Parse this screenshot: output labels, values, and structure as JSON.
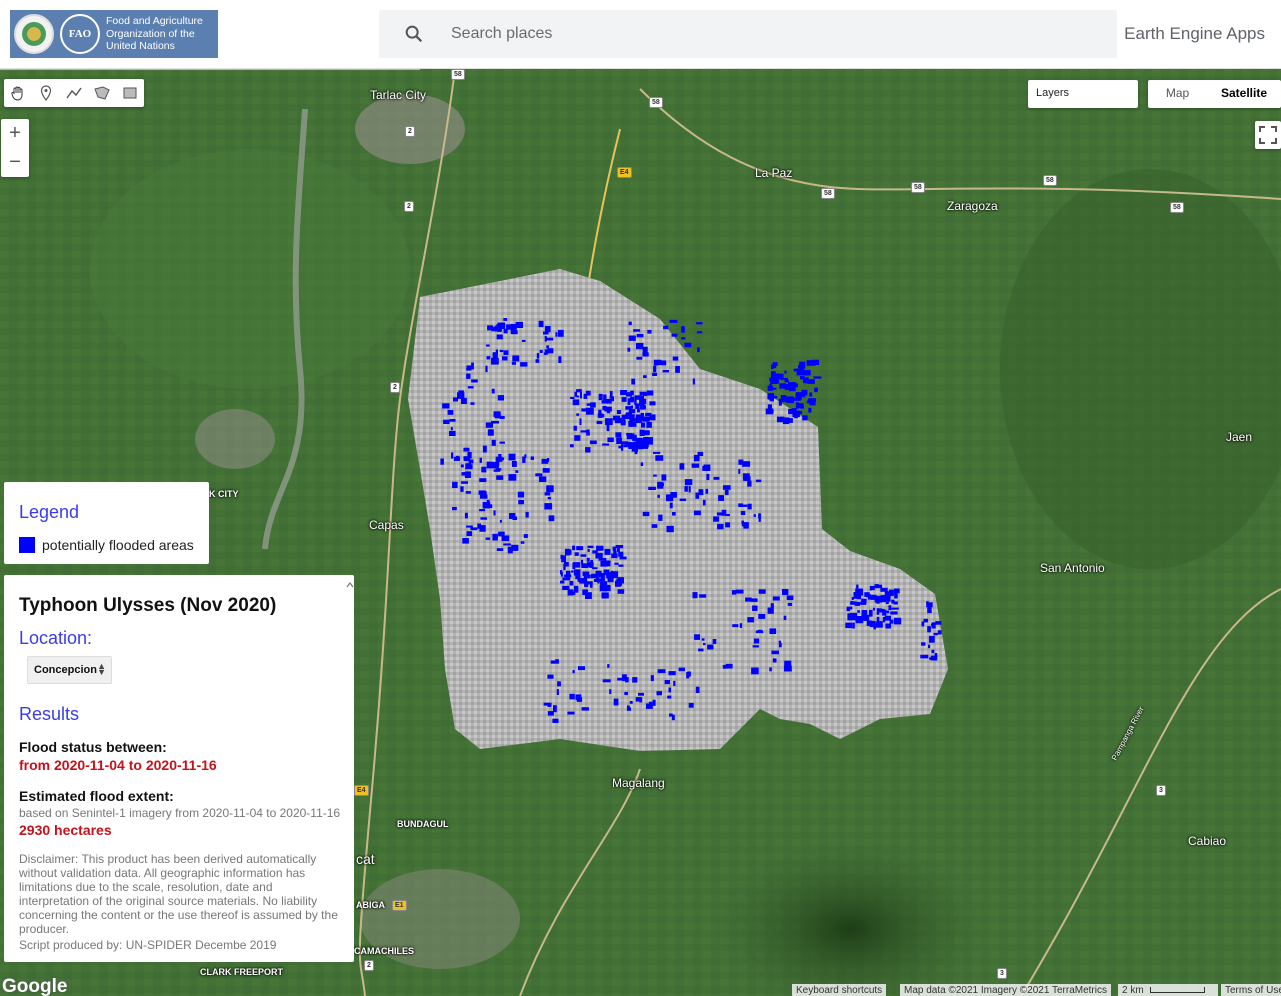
{
  "header": {
    "logo_lines": [
      "Food and Agriculture",
      "Organization of the",
      "United Nations"
    ],
    "logo_fao": "FAO",
    "search_placeholder": "Search places",
    "app_name": "Earth Engine Apps"
  },
  "map_controls": {
    "layers_label": "Layers",
    "map_label": "Map",
    "satellite_label": "Satellite",
    "zoom_in": "+",
    "zoom_out": "−",
    "draw_tools": [
      "hand-icon",
      "marker-icon",
      "polyline-icon",
      "polygon-icon",
      "rectangle-icon"
    ]
  },
  "places": [
    {
      "name": "Tarlac City"
    },
    {
      "name": "La Paz"
    },
    {
      "name": "Zaragoza"
    },
    {
      "name": "Jaen"
    },
    {
      "name": "Capas"
    },
    {
      "name": "San Antonio"
    },
    {
      "name": "Magalang"
    },
    {
      "name": "Cabiao"
    },
    {
      "name": "BUNDAGUL"
    },
    {
      "name": "ABIGA"
    },
    {
      "name": "CAMACHILES"
    },
    {
      "name": "CLARK FREEPORT"
    },
    {
      "name": "Pampanga River"
    },
    {
      "name": "K CITY"
    },
    {
      "name": "cat"
    }
  ],
  "road_badges": [
    "58",
    "58",
    "2",
    "2",
    "2",
    "E4",
    "58",
    "58",
    "58",
    "58",
    "E4",
    "E1",
    "2",
    "3",
    "3"
  ],
  "legend": {
    "title": "Legend",
    "item_label": "potentially flooded areas",
    "item_color": "#0000ff"
  },
  "panel": {
    "title": "Typhoon Ulysses (Nov 2020)",
    "location_label": "Location:",
    "location_value": "Concepcion",
    "results_label": "Results",
    "flood_status_label": "Flood status between:",
    "flood_status_value": "from 2020-11-04 to 2020-11-16",
    "extent_label": "Estimated flood extent:",
    "extent_note": "based on Senintel-1 imagery from 2020-11-04 to 2020-11-16",
    "extent_value": "2930 hectares",
    "disclaimer": "Disclaimer: This product has been derived automatically without validation data. All geographic information has limitations due to the scale, resolution, date and interpretation of the original source materials. No liability concerning the content or the use thereof is assumed by the producer.",
    "script_credit": "Script produced by: UN-SPIDER Decembe 2019"
  },
  "footer": {
    "google": "Google",
    "keyboard": "Keyboard shortcuts",
    "mapdata": "Map data ©2021 Imagery ©2021 TerraMetrics",
    "scale": "2 km",
    "terms": "Terms of Use"
  }
}
